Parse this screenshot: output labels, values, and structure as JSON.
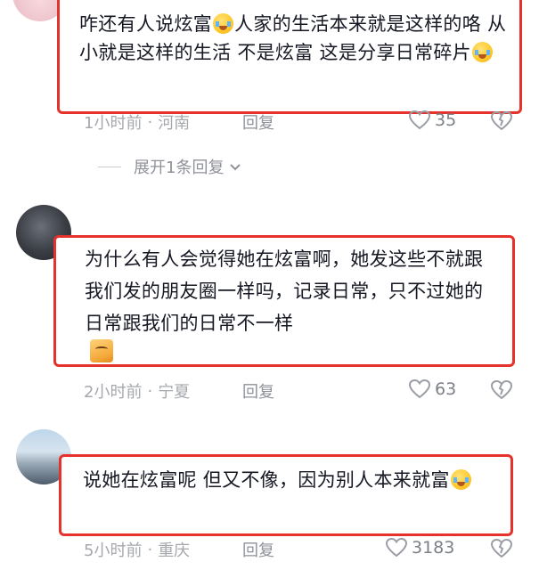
{
  "comments": [
    {
      "text_parts": [
        "咋还有人说炫富",
        "人家的生活本来就是这样的咯 从小就是这样的生活 不是炫富 这是分享日常碎片"
      ],
      "emoji_1": "crying-laughing-emoji",
      "emoji_2": "crying-emoji",
      "time": "1小时前",
      "location": "河南",
      "reply_label": "回复",
      "likes": "35"
    },
    {
      "text": "为什么有人会觉得她在炫富啊，她发这些不就跟我们发的朋友圈一样吗，记录日常，只不过她的日常跟我们的日常不一样",
      "sticker": "cat-sticker",
      "time": "2小时前",
      "location": "宁夏",
      "reply_label": "回复",
      "likes": "63"
    },
    {
      "text": "说她在炫富呢 但又不像，因为别人本来就富",
      "emoji": "crying-laughing-emoji",
      "time": "5小时前",
      "location": "重庆",
      "reply_label": "回复",
      "likes": "3183"
    }
  ],
  "expand_replies": "展开1条回复",
  "meta_separator": "·",
  "colors": {
    "highlight_border": "#e5322d",
    "meta_text": "#a6a8ae",
    "body_text": "#161823"
  }
}
